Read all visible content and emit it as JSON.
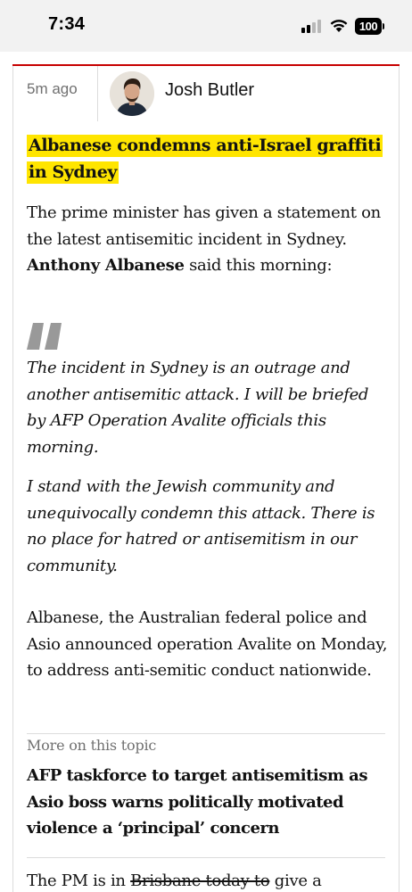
{
  "status_bar": {
    "time": "7:34",
    "battery_level": "100",
    "icons": [
      "signal-icon",
      "wifi-icon",
      "battery-icon"
    ]
  },
  "post": {
    "time_ago": "5m ago",
    "author": "Josh Butler",
    "headline": "Albanese condemns anti-Israel graffiti in Sydney",
    "highlight_color": "#ffe500",
    "accent_color": "#c70000",
    "intro_before": "The prime minister has given a statement on the latest antisemitic incident in Sydney. ",
    "intro_name": "Anthony Albanese",
    "intro_after": " said this morning:",
    "quote_paragraphs": [
      "The incident in Sydney is an outrage and another antisemitic attack. I will be briefed by AFP Operation Avalite officials this morning.",
      "I stand with the Jewish community and unequivocally condemn this attack. There is no place for hatred or antisemitism in our community."
    ],
    "body": "Albanese, the Australian federal police and Asio announced operation Avalite on Monday, to address anti-semitic conduct nationwide.",
    "more_on_topic": {
      "label": "More on this topic",
      "link_text": "AFP taskforce to target antisemitism as Asio boss warns politically motivated violence a ‘principal’ concern"
    },
    "closing_before": "The PM is in ",
    "closing_struck": "Brisbane today to",
    "closing_after": " give a"
  }
}
